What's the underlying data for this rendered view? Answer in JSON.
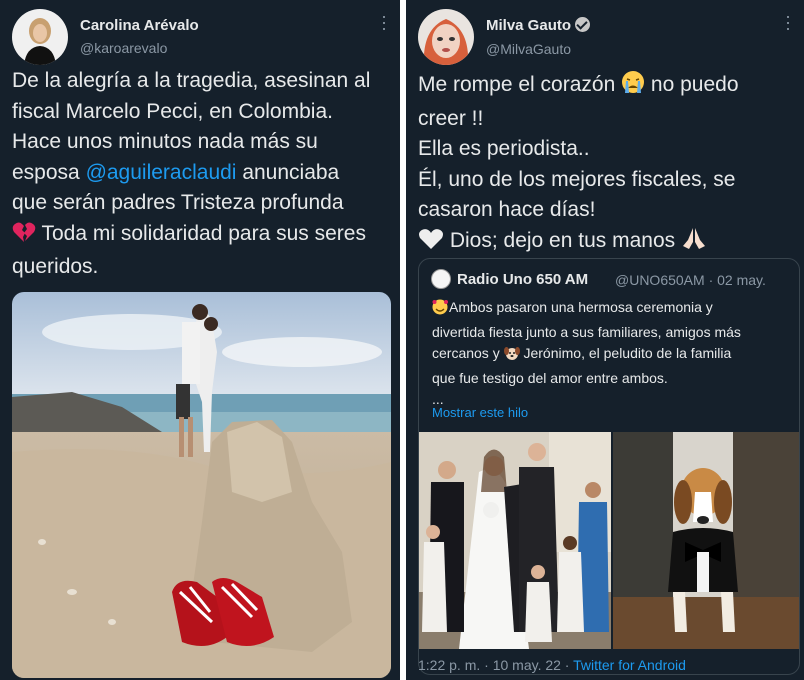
{
  "left_tweet": {
    "author_name": "Carolina Arévalo",
    "author_handle": "@karoarevalo",
    "more_icon": "more-dots-icon",
    "text_line1": "De la alegría a la tragedia, asesinan al",
    "text_line2": "fiscal Marcelo Pecci, en Colombia.",
    "text_line3": "Hace unos minutos  nada más su",
    "text_line4_pre": "esposa ",
    "mention": "@aguileraclaudi",
    "text_line4_post": " anunciaba",
    "text_line5": "que serán padres   Tristeza profunda",
    "text_line6": " Toda mi solidaridad para sus seres",
    "text_line7": "queridos.",
    "emoji_broken_heart": "broken-heart-icon",
    "image": "beach-photo-with-sandcastle-and-red-baby-shoes"
  },
  "right_tweet": {
    "author_name": "Milva Gauto",
    "author_handle": "@MilvaGauto",
    "verified_icon": "verified-badge-icon",
    "text_line1_pre": "Me rompe el corazón ",
    "text_line1_post": " no puedo",
    "text_line2": "creer !!",
    "text_line3": "Ella es periodista..",
    "text_line4": "Él, uno de los mejores fiscales, se",
    "text_line5": "casaron hace días!",
    "text_line6": " Dios; dejo en tus manos ",
    "quote": {
      "name": "Radio Uno 650 AM",
      "handle_and_date": "@UNO650AM · 02 may.",
      "line1": "Ambos pasaron una hermosa ceremonia y",
      "line2": "divertida fiesta junto a sus familiares, amigos más",
      "line3_pre": "cercanos y ",
      "line3_post": " Jerónimo, el peludito de la familia",
      "line4": "que fue testigo del amor entre ambos.",
      "line5": "...",
      "show_thread": "Mostrar este hilo"
    },
    "footer_time": "1:22 p. m. · 10 may. 22 · ",
    "footer_client": "Twitter for Android"
  },
  "colors": {
    "background": "#15202b",
    "text": "#e7e9ea",
    "secondary": "#8b98a5",
    "link": "#1d9bf0"
  }
}
